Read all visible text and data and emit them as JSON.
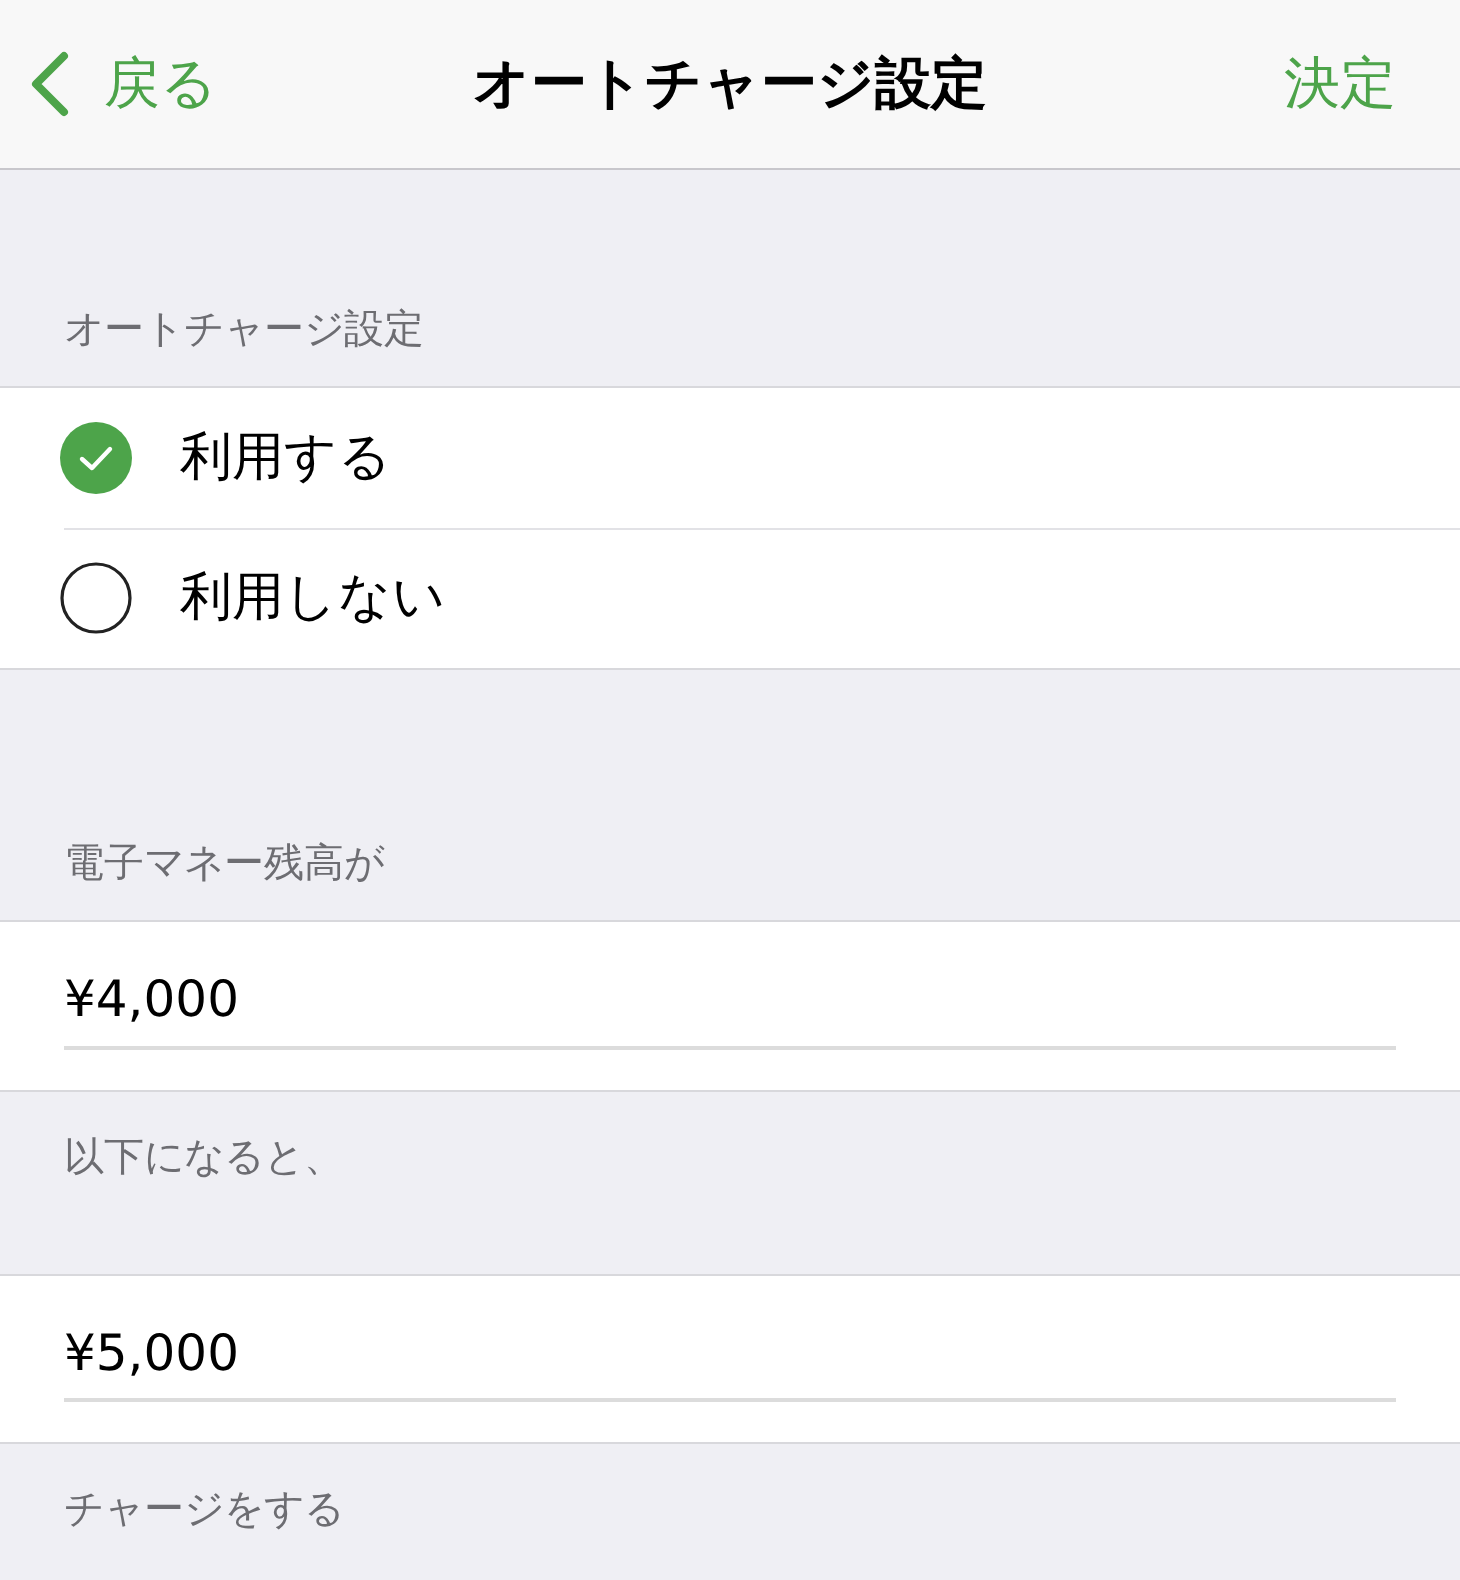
{
  "nav": {
    "back": "戻る",
    "title": "オートチャージ設定",
    "done": "決定"
  },
  "sections": [
    {
      "kind": "radio",
      "header": "オートチャージ設定",
      "options": [
        {
          "label": "利用する",
          "selected": true
        },
        {
          "label": "利用しない",
          "selected": false
        }
      ]
    },
    {
      "kind": "field",
      "header": "電子マネー残高が",
      "value": "¥4,000",
      "footer": "以下になると、"
    },
    {
      "kind": "field",
      "value": "¥5,000",
      "footer": "チャージをする"
    }
  ]
}
